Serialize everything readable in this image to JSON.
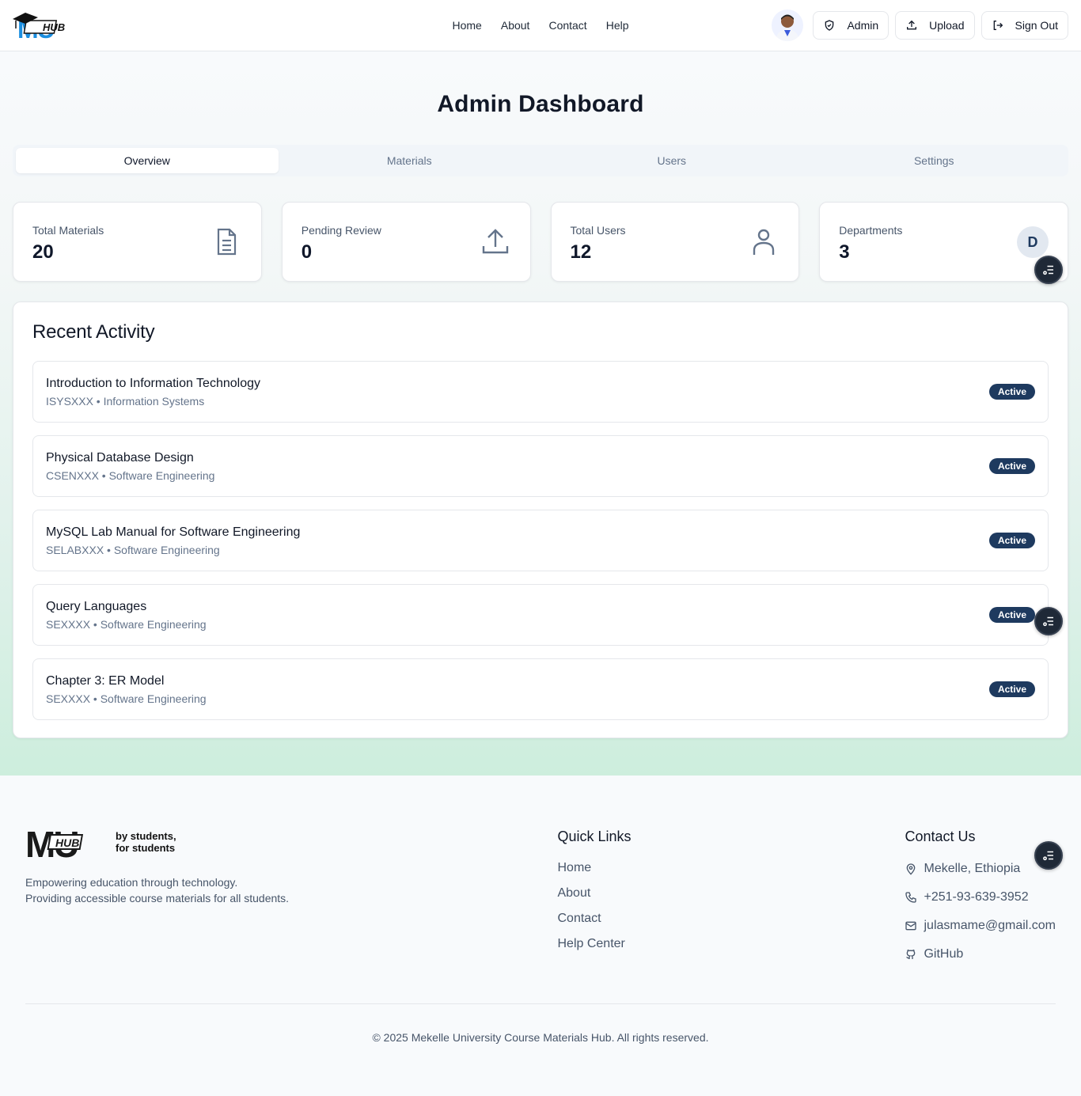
{
  "header": {
    "nav": [
      "Home",
      "About",
      "Contact",
      "Help"
    ],
    "admin_label": "Admin",
    "upload_label": "Upload",
    "signout_label": "Sign Out",
    "logo_text": "HUB"
  },
  "main": {
    "title": "Admin Dashboard",
    "tabs": [
      "Overview",
      "Materials",
      "Users",
      "Settings"
    ],
    "active_tab": "Overview",
    "stats": [
      {
        "label": "Total Materials",
        "value": "20",
        "icon": "document-icon"
      },
      {
        "label": "Pending Review",
        "value": "0",
        "icon": "upload-icon"
      },
      {
        "label": "Total Users",
        "value": "12",
        "icon": "user-icon"
      },
      {
        "label": "Departments",
        "value": "3",
        "icon_text": "D"
      }
    ],
    "activity_title": "Recent Activity",
    "activity": [
      {
        "title": "Introduction to Information Technology",
        "sub": "ISYSXXX • Information Systems",
        "status": "Active"
      },
      {
        "title": "Physical Database Design",
        "sub": "CSENXXX • Software Engineering",
        "status": "Active"
      },
      {
        "title": "MySQL Lab Manual for Software Engineering",
        "sub": "SELABXXX • Software Engineering",
        "status": "Active"
      },
      {
        "title": "Query Languages",
        "sub": "SEXXXX • Software Engineering",
        "status": "Active"
      },
      {
        "title": "Chapter 3: ER Model",
        "sub": "SEXXXX • Software Engineering",
        "status": "Active"
      }
    ]
  },
  "footer": {
    "brand_tagline_1": "by students,",
    "brand_tagline_2": "for students",
    "desc_1": "Empowering education through technology.",
    "desc_2": "Providing accessible course materials for all students.",
    "quick_links_heading": "Quick Links",
    "quick_links": [
      "Home",
      "About",
      "Contact",
      "Help Center"
    ],
    "contact_heading": "Contact Us",
    "contact": {
      "location": "Mekelle, Ethiopia",
      "phone": "+251-93-639-3952",
      "email": "julasmame@gmail.com",
      "github": "GitHub"
    },
    "copyright": "© 2025 Mekelle University Course Materials Hub. All rights reserved."
  },
  "colors": {
    "primary": "#1e3a5f",
    "logo_blue": "#1d8fe0",
    "icon_gray": "#64748b"
  }
}
